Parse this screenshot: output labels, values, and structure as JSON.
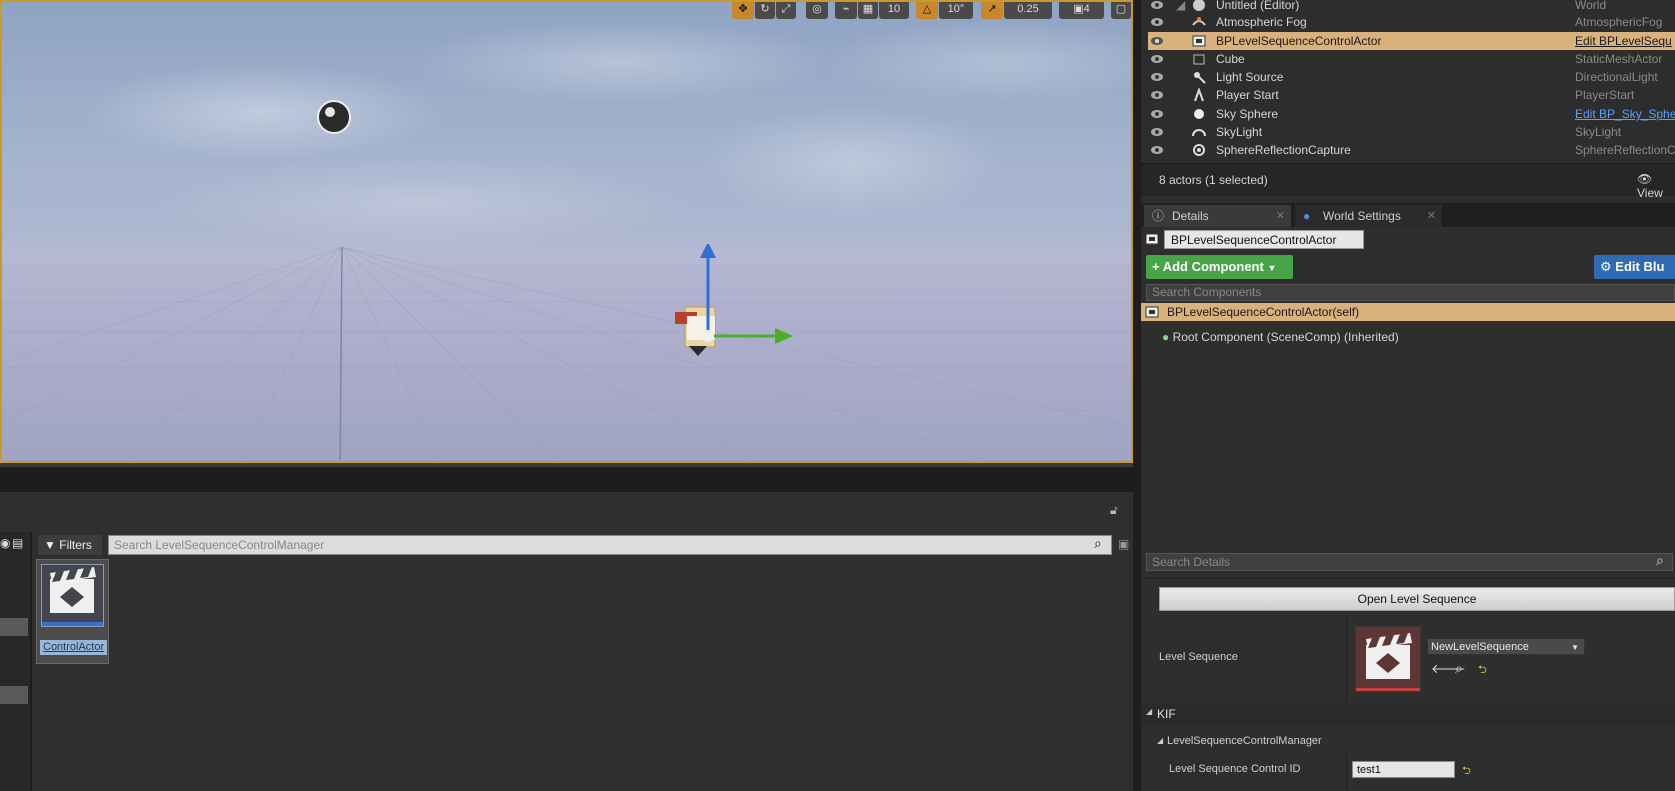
{
  "viewport": {
    "toolbar": {
      "grid_snap_value": "10",
      "rotation_snap_value": "10°",
      "scale_snap_value": "0.25",
      "camera_speed_value": "4"
    }
  },
  "outliner": {
    "rows": [
      {
        "name": "Untitled (Editor)",
        "type": "World",
        "type_is_link": false,
        "selected": false,
        "icon": "world-icon"
      },
      {
        "name": "Atmospheric Fog",
        "type": "AtmosphericFog",
        "type_is_link": false,
        "selected": false,
        "icon": "fog-icon"
      },
      {
        "name": "BPLevelSequenceControlActor",
        "type": "Edit BPLevelSequ",
        "type_is_link": true,
        "selected": true,
        "icon": "blueprint-actor-icon"
      },
      {
        "name": "Cube",
        "type": "StaticMeshActor",
        "type_is_link": false,
        "selected": false,
        "icon": "static-mesh-icon"
      },
      {
        "name": "Light Source",
        "type": "DirectionalLight",
        "type_is_link": false,
        "selected": false,
        "icon": "directional-light-icon"
      },
      {
        "name": "Player Start",
        "type": "PlayerStart",
        "type_is_link": false,
        "selected": false,
        "icon": "player-start-icon"
      },
      {
        "name": "Sky Sphere",
        "type": "Edit BP_Sky_Sphe",
        "type_is_link": true,
        "selected": false,
        "icon": "sphere-icon"
      },
      {
        "name": "SkyLight",
        "type": "SkyLight",
        "type_is_link": false,
        "selected": false,
        "icon": "skylight-icon"
      },
      {
        "name": "SphereReflectionCapture",
        "type": "SphereReflectionCa",
        "type_is_link": false,
        "selected": false,
        "icon": "reflection-capture-icon"
      }
    ],
    "footer_count": "8 actors (1 selected)",
    "view_options_label": "View"
  },
  "tabs": [
    {
      "label": "Details",
      "active": true
    },
    {
      "label": "World Settings",
      "active": false
    }
  ],
  "details": {
    "actor_name": "BPLevelSequenceControlActor",
    "add_component_label": "+ Add Component",
    "edit_blueprint_label": "Edit Blu",
    "search_components_placeholder": "Search Components",
    "component_self": "BPLevelSequenceControlActor(self)",
    "component_root": "Root Component (SceneComp) (Inherited)",
    "search_details_placeholder": "Search Details",
    "open_level_sequence_label": "Open Level Sequence",
    "level_sequence_label": "Level Sequence",
    "level_sequence_value": "NewLevelSequence",
    "category_kif": "KIF",
    "subcategory_lsm": "LevelSequenceControlManager",
    "control_id_label": "Level Sequence Control ID",
    "control_id_value": "test1"
  },
  "content_browser": {
    "filters_label": "Filters",
    "search_placeholder": "Search LevelSequenceControlManager",
    "asset_name": "ControlActor"
  },
  "colors": {
    "selection": "#d9b17d",
    "add_component": "#47a447",
    "edit_blueprint": "#2e6bb3",
    "viewport_border": "#c89a2c",
    "link": "#5aa0ff"
  }
}
